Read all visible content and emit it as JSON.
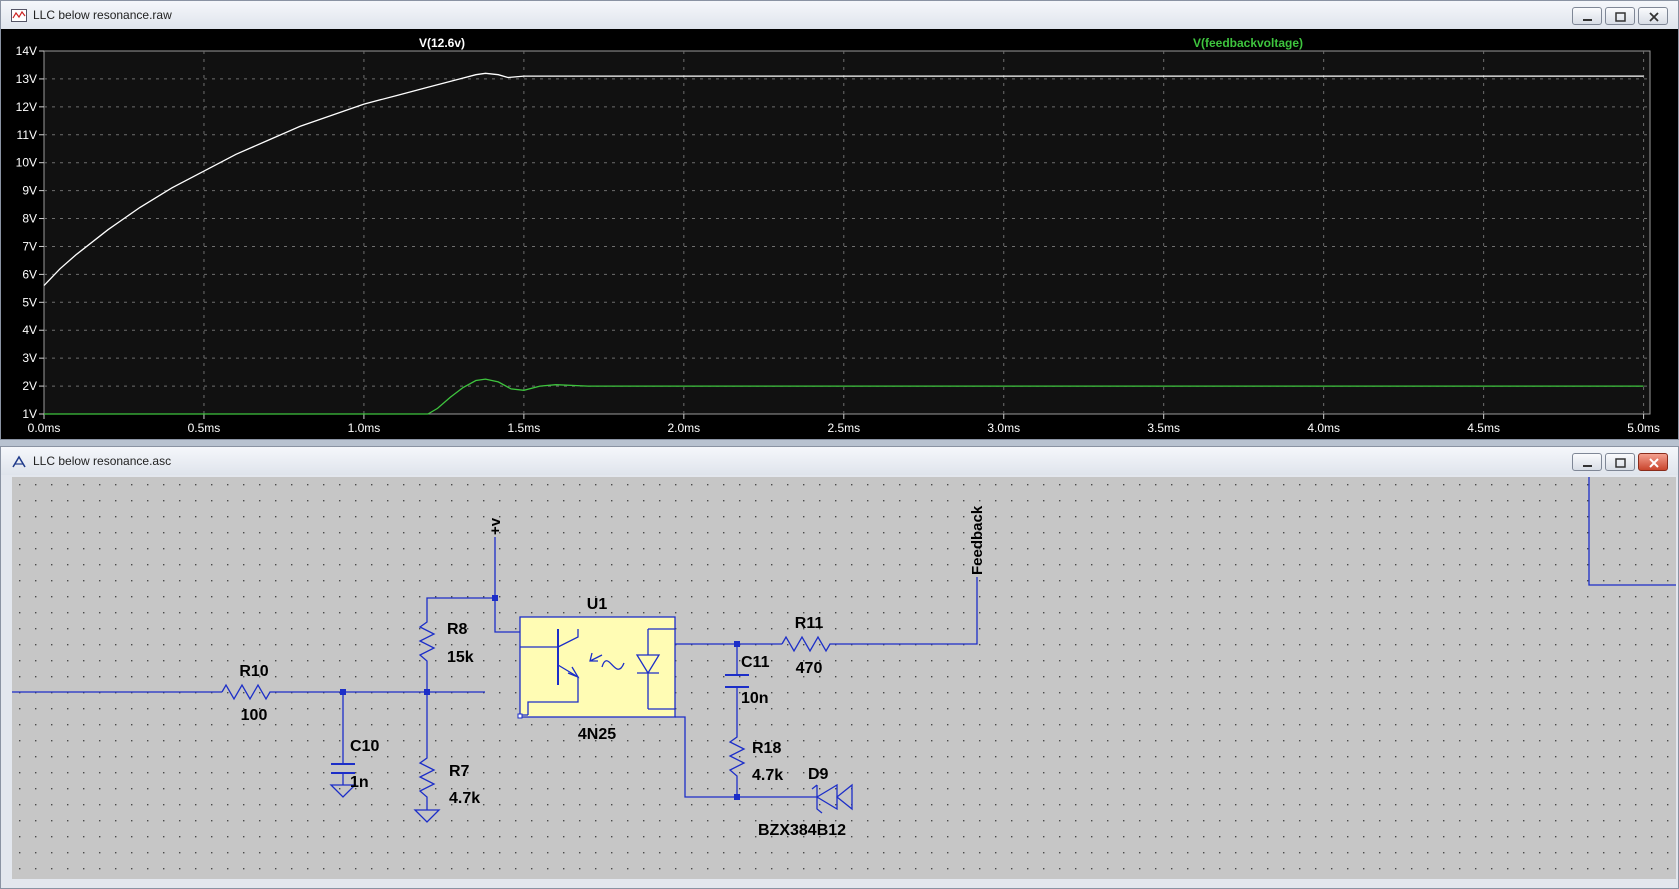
{
  "plot_window": {
    "title": "LLC below resonance.raw",
    "traces": [
      {
        "name": "V(12.6v)",
        "color": "#ffffff"
      },
      {
        "name": "V(feedbackvoltage)",
        "color": "#3ec43e"
      }
    ]
  },
  "schematic_window": {
    "title": "LLC below resonance.asc",
    "components": {
      "r10": {
        "ref": "R10",
        "value": "100"
      },
      "c10": {
        "ref": "C10",
        "value": "1n"
      },
      "r8": {
        "ref": "R8",
        "value": "15k"
      },
      "r7": {
        "ref": "R7",
        "value": "4.7k"
      },
      "u1": {
        "ref": "U1",
        "value": "4N25"
      },
      "c11": {
        "ref": "C11",
        "value": "10n"
      },
      "r11": {
        "ref": "R11",
        "value": "470"
      },
      "r18": {
        "ref": "R18",
        "value": "4.7k"
      },
      "d9": {
        "ref": "D9",
        "value": "BZX384B12"
      }
    },
    "net_labels": {
      "supply": "+v",
      "feedback": "Feedback"
    }
  },
  "chart_data": {
    "type": "line",
    "title": "",
    "xlabel": "",
    "ylabel": "",
    "x_ticks": [
      "0.0ms",
      "0.5ms",
      "1.0ms",
      "1.5ms",
      "2.0ms",
      "2.5ms",
      "3.0ms",
      "3.5ms",
      "4.0ms",
      "4.5ms",
      "5.0ms"
    ],
    "y_ticks": [
      "1V",
      "2V",
      "3V",
      "4V",
      "5V",
      "6V",
      "7V",
      "8V",
      "9V",
      "10V",
      "11V",
      "12V",
      "13V",
      "14V"
    ],
    "xlim": [
      0,
      5.02
    ],
    "ylim": [
      1,
      14
    ],
    "x_unit": "ms",
    "y_unit": "V",
    "grid": true,
    "legend": "top",
    "series": [
      {
        "name": "V(12.6v)",
        "color": "#ffffff",
        "x": [
          0.0,
          0.05,
          0.1,
          0.2,
          0.3,
          0.4,
          0.5,
          0.6,
          0.7,
          0.8,
          0.9,
          1.0,
          1.1,
          1.2,
          1.3,
          1.35,
          1.38,
          1.42,
          1.45,
          1.5,
          1.6,
          2.0,
          3.0,
          4.0,
          5.0
        ],
        "y": [
          5.6,
          6.2,
          6.7,
          7.6,
          8.4,
          9.1,
          9.7,
          10.3,
          10.8,
          11.3,
          11.7,
          12.1,
          12.4,
          12.7,
          13.0,
          13.15,
          13.2,
          13.15,
          13.05,
          13.1,
          13.1,
          13.1,
          13.1,
          13.1,
          13.1
        ]
      },
      {
        "name": "V(feedbackvoltage)",
        "color": "#3ec43e",
        "x": [
          0.0,
          1.2,
          1.23,
          1.27,
          1.31,
          1.35,
          1.38,
          1.42,
          1.46,
          1.5,
          1.55,
          1.6,
          1.7,
          2.0,
          3.0,
          4.0,
          5.0
        ],
        "y": [
          1.0,
          1.0,
          1.2,
          1.6,
          1.95,
          2.2,
          2.25,
          2.15,
          1.9,
          1.85,
          2.0,
          2.05,
          2.0,
          2.0,
          2.0,
          2.0,
          2.0
        ]
      }
    ]
  }
}
